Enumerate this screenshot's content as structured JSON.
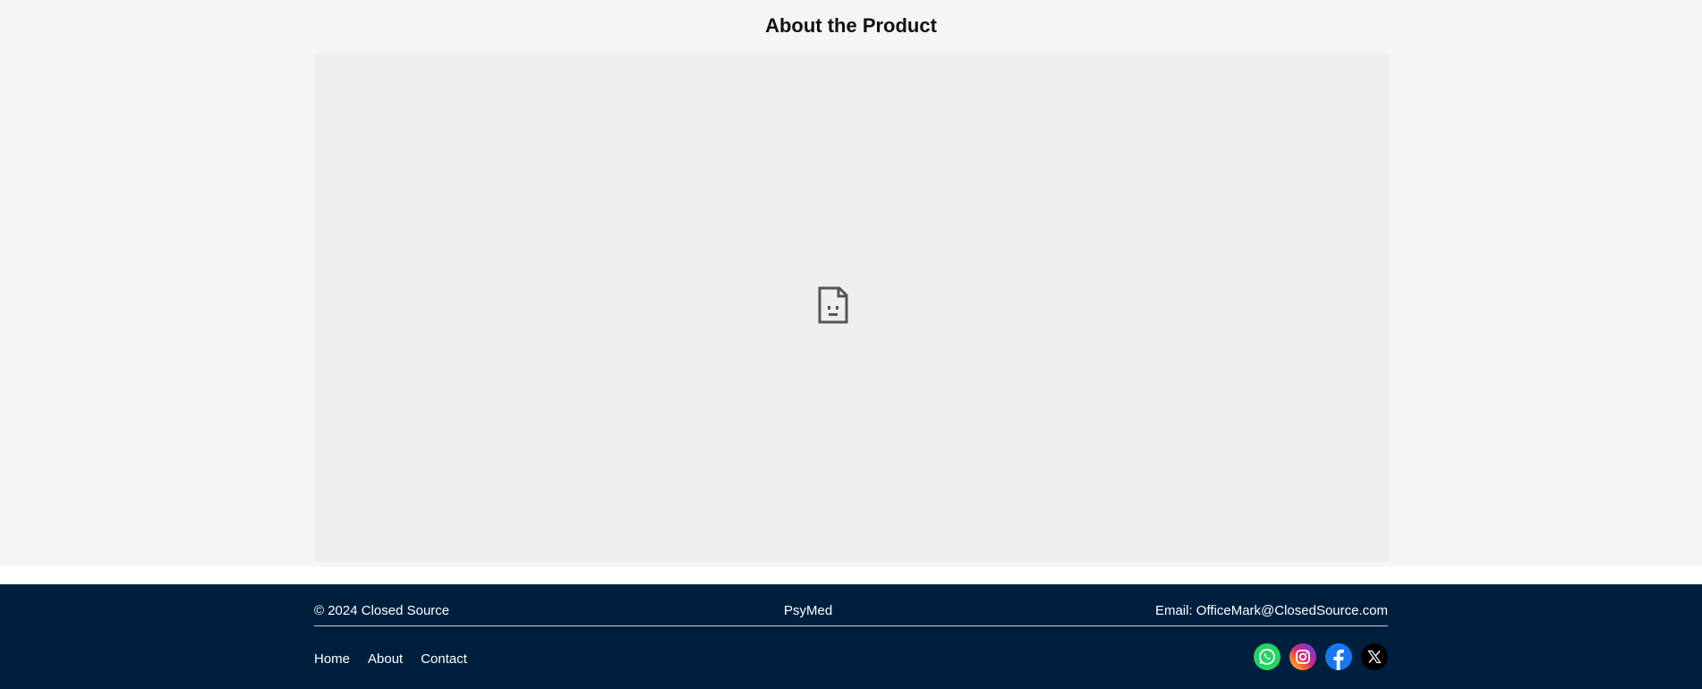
{
  "section": {
    "title": "About the Product",
    "embed_icon": "broken-document-icon"
  },
  "footer": {
    "copyright": "© 2024 Closed Source",
    "brand": "PsyMed",
    "email": "Email: OfficeMark@ClosedSource.com",
    "nav": [
      {
        "label": "Home"
      },
      {
        "label": "About"
      },
      {
        "label": "Contact"
      }
    ],
    "social": [
      {
        "icon": "whatsapp-icon",
        "color": "#25d366"
      },
      {
        "icon": "instagram-icon",
        "color": "#e1306c"
      },
      {
        "icon": "facebook-icon",
        "color": "#1877f2"
      },
      {
        "icon": "x-icon",
        "color": "#000000"
      }
    ]
  },
  "colors": {
    "page_bg": "#f5f5f5",
    "embed_bg": "#eeeeee",
    "footer_bg": "#001f3f"
  }
}
